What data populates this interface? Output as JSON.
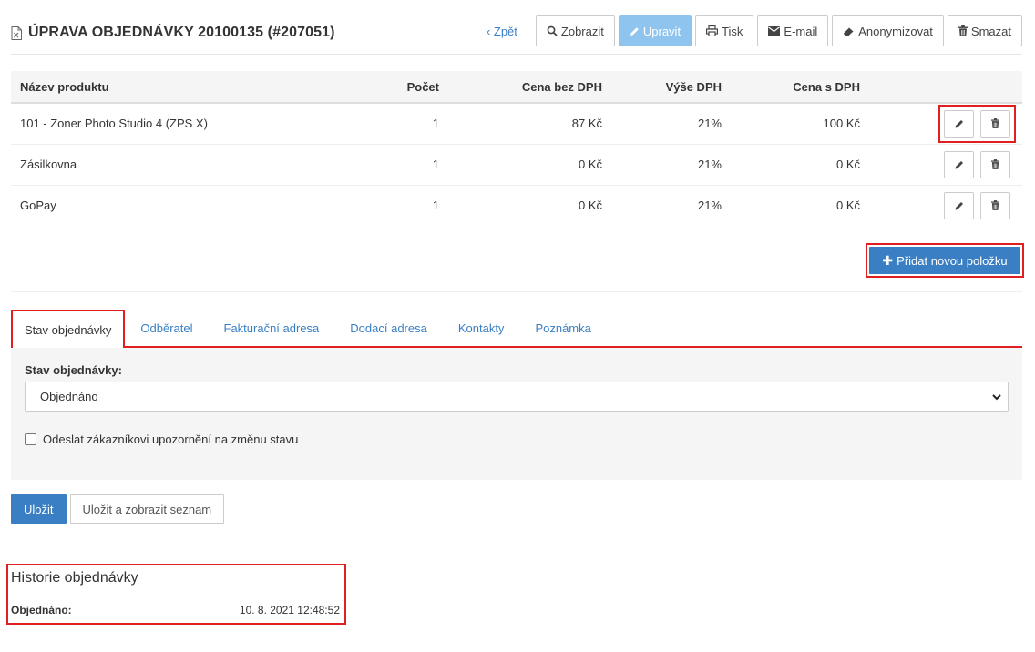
{
  "header": {
    "title": "ÚPRAVA OBJEDNÁVKY 20100135 (#207051)",
    "back_label": "‹ Zpět",
    "buttons": {
      "view": "Zobrazit",
      "edit": "Upravit",
      "print": "Tisk",
      "email": "E-mail",
      "anonymize": "Anonymizovat",
      "delete": "Smazat"
    }
  },
  "table": {
    "columns": [
      "Název produktu",
      "Počet",
      "Cena bez DPH",
      "Výše DPH",
      "Cena s DPH"
    ],
    "rows": [
      {
        "name": "101 - Zoner Photo Studio 4 (ZPS X)",
        "qty": "1",
        "price": "87 Kč",
        "vat": "21%",
        "total": "100 Kč"
      },
      {
        "name": "Zásilkovna",
        "qty": "1",
        "price": "0 Kč",
        "vat": "21%",
        "total": "0 Kč"
      },
      {
        "name": "GoPay",
        "qty": "1",
        "price": "0 Kč",
        "vat": "21%",
        "total": "0 Kč"
      }
    ],
    "add_item_label": "Přidat novou položku"
  },
  "tabs": {
    "items": [
      "Stav objednávky",
      "Odběratel",
      "Fakturační adresa",
      "Dodací adresa",
      "Kontakty",
      "Poznámka"
    ],
    "active": "Stav objednávky"
  },
  "status_panel": {
    "label": "Stav objednávky:",
    "selected": "Objednáno",
    "notify_label": "Odeslat zákazníkovi upozornění na změnu stavu",
    "notify_checked": false
  },
  "actions": {
    "save": "Uložit",
    "save_and_list": "Uložit a zobrazit seznam"
  },
  "history": {
    "title": "Historie objednávky",
    "entries": [
      {
        "label": "Objednáno:",
        "value": "10. 8. 2021 12:48:52"
      }
    ]
  },
  "colors": {
    "primary": "#3a7fc4",
    "active_button": "#8fc4ee",
    "highlight": "#e02020",
    "panel_bg": "#f5f5f5"
  },
  "icons": [
    "document-icon",
    "search-icon",
    "pencil-icon",
    "print-icon",
    "envelope-icon",
    "eraser-icon",
    "trash-icon",
    "plus-icon",
    "chevron-down-icon"
  ]
}
